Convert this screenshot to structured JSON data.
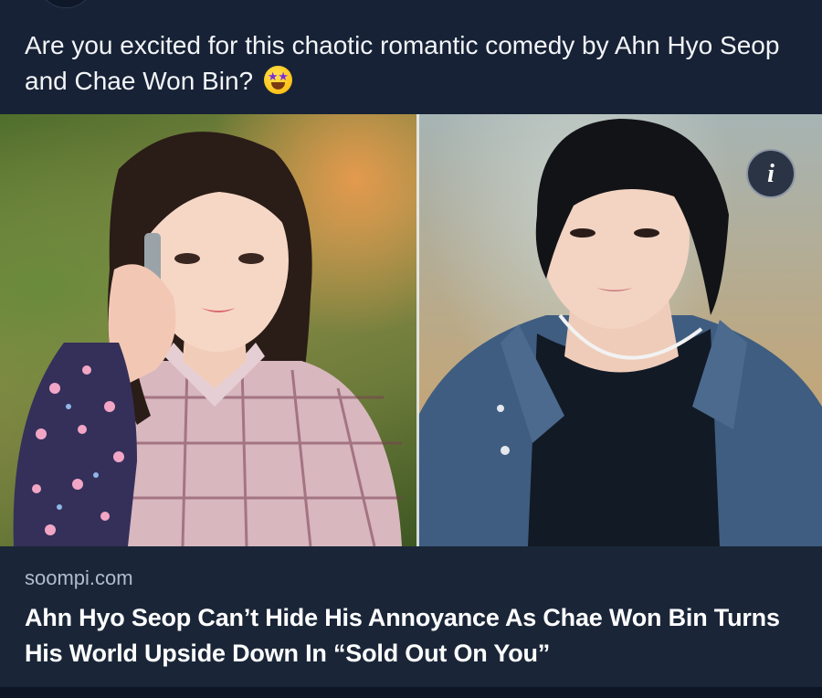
{
  "post": {
    "text": "Are you excited for this chaotic romantic comedy by Ahn Hyo Seop and Chae Won Bin?",
    "emoji": "star-struck-emoji"
  },
  "image": {
    "info_icon": "i"
  },
  "link": {
    "source": "soompi.com",
    "headline": "Ahn Hyo Seop Can’t Hide His Annoyance As Chae Won Bin Turns His World Upside Down In “Sold Out On You”"
  },
  "colors": {
    "background": "#172236",
    "card": "#1a2638",
    "source_text": "#b2bccb",
    "text": "#ffffff"
  }
}
